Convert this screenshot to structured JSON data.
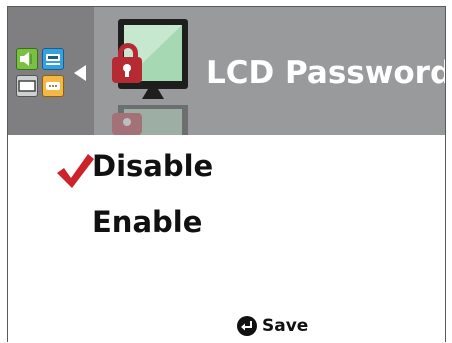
{
  "header": {
    "title": "LCD Password",
    "back_icon": "back-arrow-icon",
    "section_icon": "monitor-lock-icon",
    "menu_icons": [
      "speaker-icon",
      "hdmi-icon",
      "display-icon",
      "vga-icon"
    ]
  },
  "options": [
    {
      "label": "Disable",
      "selected": true
    },
    {
      "label": "Enable",
      "selected": false
    }
  ],
  "footer": {
    "save_label": "Save",
    "save_icon": "enter-key-icon"
  },
  "colors": {
    "header_bg": "#999a9c",
    "side_panel_bg": "#7f7f81",
    "check_red": "#cc2229",
    "lock_red": "#b52a33",
    "screen_green": "#a6d8b4"
  }
}
